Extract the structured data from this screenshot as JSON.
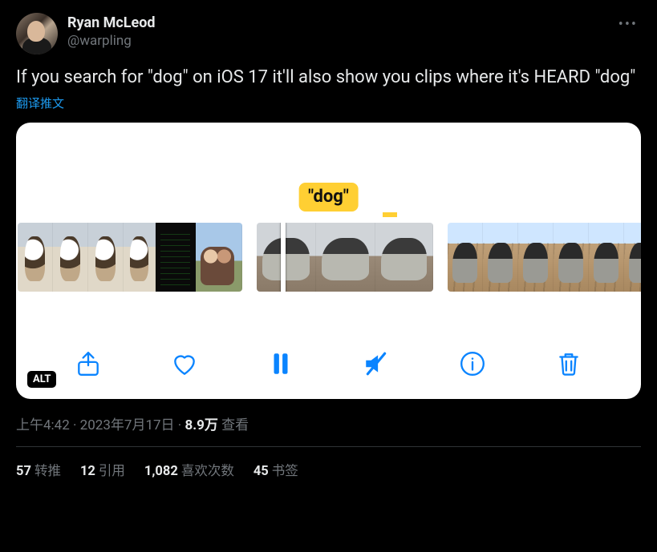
{
  "author": {
    "display_name": "Ryan McLeod",
    "handle": "@warpling"
  },
  "tweet_text": "If you search for \"dog\" on iOS 17 it'll also show you clips where it's HEARD \"dog\"",
  "translate_label": "翻译推文",
  "media": {
    "search_label": "\"dog\"",
    "alt_badge": "ALT"
  },
  "meta": {
    "time": "上午4:42",
    "date": "2023年7月17日",
    "views_number": "8.9万",
    "views_label": "查看"
  },
  "stats": {
    "retweets": {
      "count": "57",
      "label": "转推"
    },
    "quotes": {
      "count": "12",
      "label": "引用"
    },
    "likes": {
      "count": "1,082",
      "label": "喜欢次数"
    },
    "bookmarks": {
      "count": "45",
      "label": "书签"
    }
  }
}
